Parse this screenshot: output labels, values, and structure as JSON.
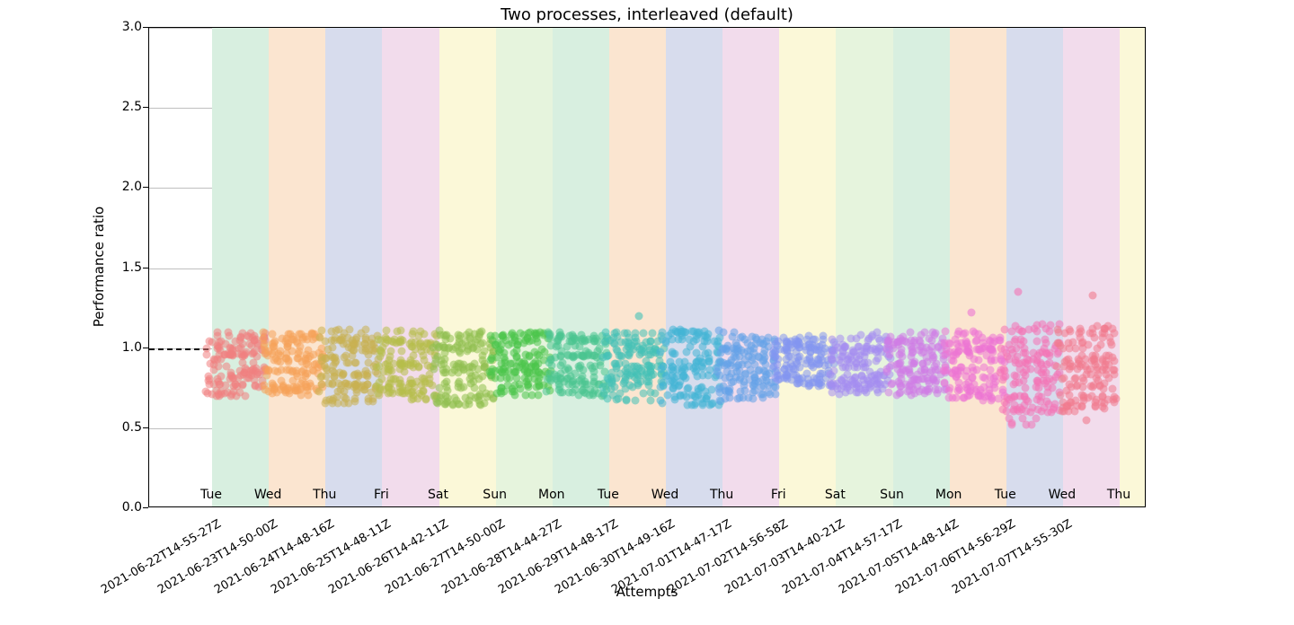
{
  "chart_data": {
    "type": "scatter",
    "title": "Two processes, interleaved (default)",
    "xlabel": "Attempts",
    "ylabel": "Performance ratio",
    "ylim": [
      0.0,
      3.0
    ],
    "yticks": [
      0.0,
      0.5,
      1.0,
      1.5,
      2.0,
      2.5,
      3.0
    ],
    "reference_y": 1.0,
    "band_colors": [
      "#d8efe0",
      "#fbe5d0",
      "#d7dced",
      "#f2dcec",
      "#fbf8d8",
      "#e6f4dd"
    ],
    "days": [
      {
        "timestamp": "2021-06-22T14-55-27Z",
        "weekday": "Tue",
        "color": "#f08080",
        "attempts": 5,
        "mean": 1.0,
        "spread": 0.1,
        "outliers": [
          0.76
        ]
      },
      {
        "timestamp": "2021-06-23T14-50-00Z",
        "weekday": "Wed",
        "color": "#f5a25a",
        "attempts": 5,
        "mean": 1.0,
        "spread": 0.1,
        "outliers": []
      },
      {
        "timestamp": "2021-06-24T14-48-16Z",
        "weekday": "Thu",
        "color": "#c9b050",
        "attempts": 5,
        "mean": 1.0,
        "spread": 0.12,
        "outliers": [
          0.78
        ]
      },
      {
        "timestamp": "2021-06-25T14-48-11Z",
        "weekday": "Fri",
        "color": "#b7bd4a",
        "attempts": 5,
        "mean": 1.0,
        "spread": 0.11,
        "outliers": [
          0.78
        ]
      },
      {
        "timestamp": "2021-06-26T14-42-11Z",
        "weekday": "Sat",
        "color": "#8fc050",
        "attempts": 5,
        "mean": 1.0,
        "spread": 0.12,
        "outliers": [
          0.78
        ]
      },
      {
        "timestamp": "2021-06-27T14-50-00Z",
        "weekday": "Sun",
        "color": "#4bc44b",
        "attempts": 5,
        "mean": 1.0,
        "spread": 0.1,
        "outliers": []
      },
      {
        "timestamp": "2021-06-28T14-44-27Z",
        "weekday": "Mon",
        "color": "#4ac590",
        "attempts": 5,
        "mean": 1.0,
        "spread": 0.1,
        "outliers": []
      },
      {
        "timestamp": "2021-06-29T14-48-17Z",
        "weekday": "Tue",
        "color": "#44c1b7",
        "attempts": 5,
        "mean": 1.0,
        "spread": 0.11,
        "outliers": [
          1.2
        ]
      },
      {
        "timestamp": "2021-06-30T14-49-16Z",
        "weekday": "Wed",
        "color": "#43b4d6",
        "attempts": 5,
        "mean": 1.0,
        "spread": 0.12,
        "outliers": []
      },
      {
        "timestamp": "2021-07-01T14-47-17Z",
        "weekday": "Thu",
        "color": "#64a2e8",
        "attempts": 5,
        "mean": 1.0,
        "spread": 0.11,
        "outliers": [
          0.78
        ]
      },
      {
        "timestamp": "2021-07-02T14-56-58Z",
        "weekday": "Fri",
        "color": "#8495f0",
        "attempts": 5,
        "mean": 1.0,
        "spread": 0.08,
        "outliers": []
      },
      {
        "timestamp": "2021-07-03T14-40-21Z",
        "weekday": "Sat",
        "color": "#a48cf0",
        "attempts": 5,
        "mean": 1.0,
        "spread": 0.1,
        "outliers": [
          0.82
        ]
      },
      {
        "timestamp": "2021-07-04T14-57-17Z",
        "weekday": "Sun",
        "color": "#d07ce6",
        "attempts": 5,
        "mean": 1.0,
        "spread": 0.1,
        "outliers": [
          0.8
        ]
      },
      {
        "timestamp": "2021-07-05T14-48-14Z",
        "weekday": "Mon",
        "color": "#ed74d4",
        "attempts": 5,
        "mean": 1.0,
        "spread": 0.11,
        "outliers": [
          1.22
        ]
      },
      {
        "timestamp": "2021-07-06T14-56-29Z",
        "weekday": "Tue",
        "color": "#f473b4",
        "attempts": 5,
        "mean": 1.0,
        "spread": 0.16,
        "outliers": [
          1.35,
          0.7
        ]
      },
      {
        "timestamp": "2021-07-07T14-55-30Z",
        "weekday": "Wed",
        "color": "#f07a8e",
        "attempts": 5,
        "mean": 1.01,
        "spread": 0.14,
        "outliers": [
          1.33,
          0.55
        ]
      }
    ],
    "trailing_weekday": "Thu"
  }
}
